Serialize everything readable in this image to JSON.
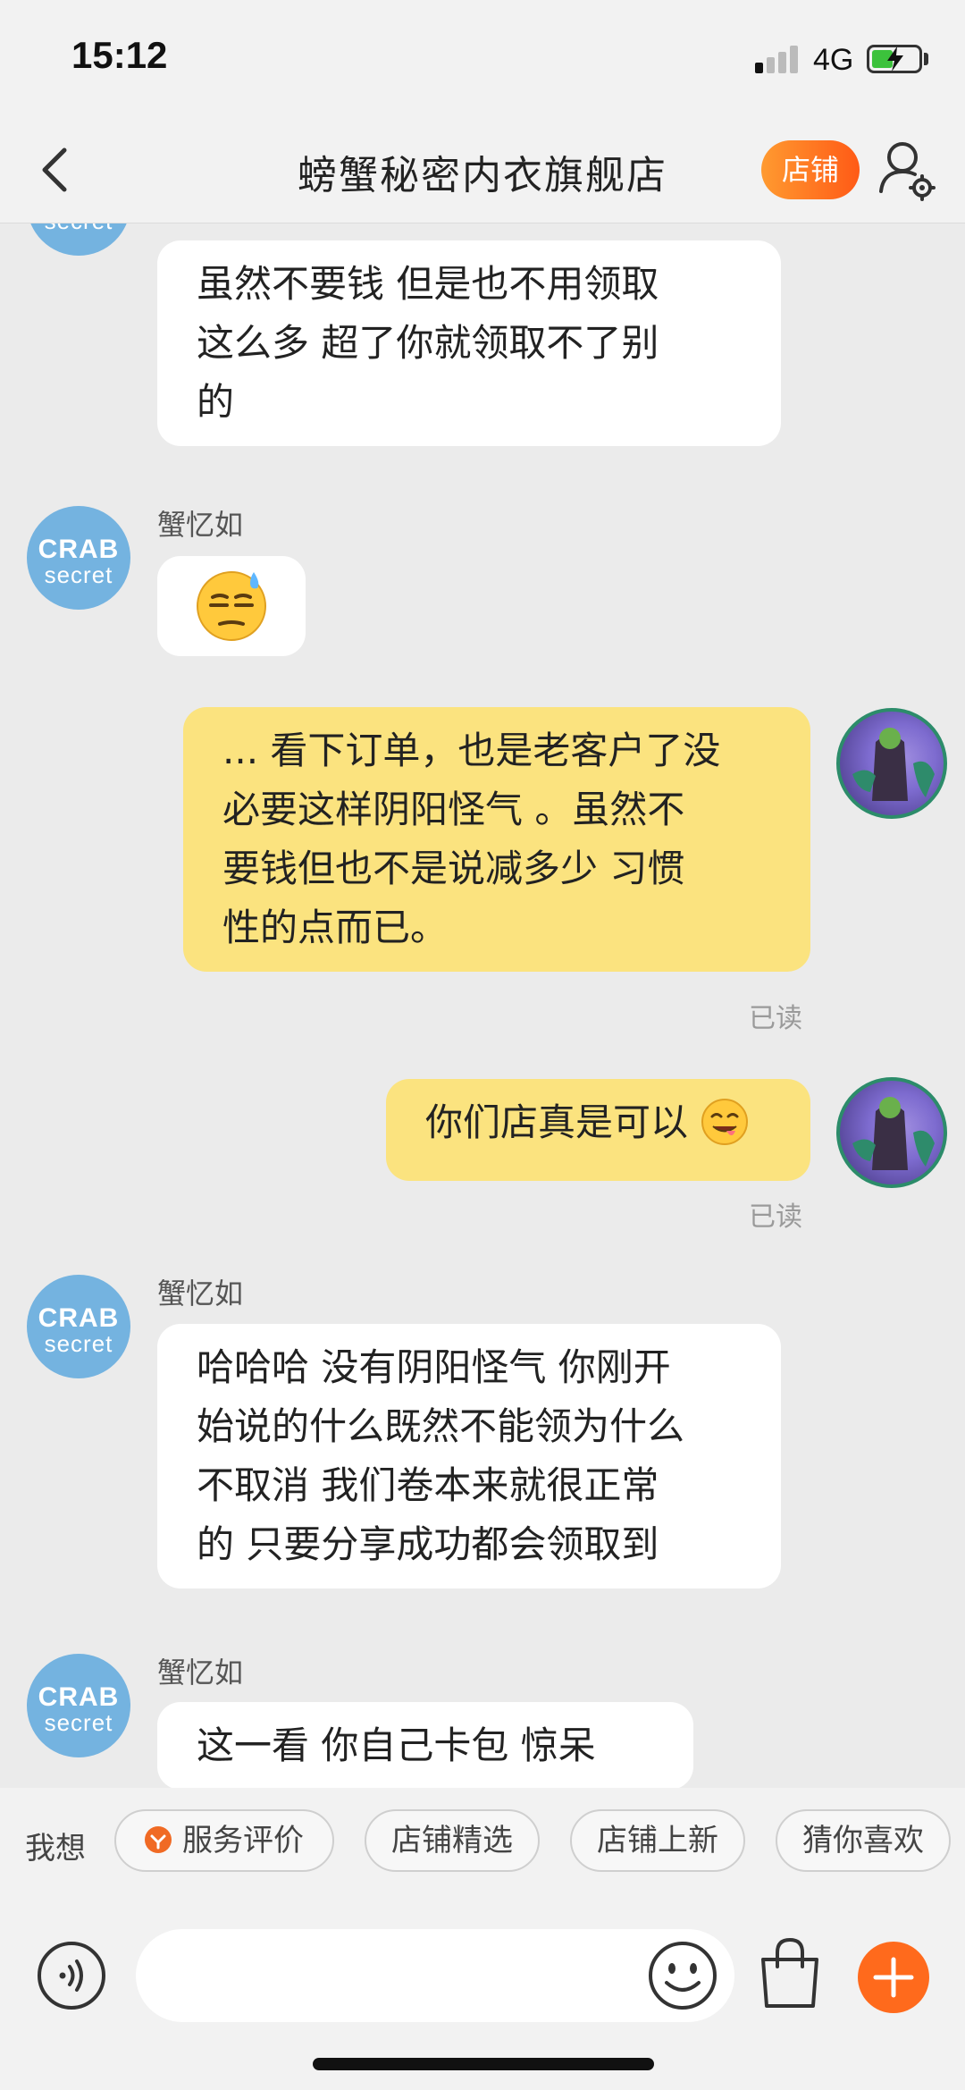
{
  "status_bar": {
    "time": "15:12",
    "network": "4G",
    "signal_bars_active": 1,
    "battery_level": 0.45,
    "battery_charging": true
  },
  "nav": {
    "back_icon": "chevron-left-icon",
    "title": "螃蟹秘密内衣旗舰店",
    "shop_button_label": "店铺",
    "user_settings_icon": "user-settings-icon"
  },
  "colors": {
    "accent_orange": "#ff6a1c",
    "my_bubble": "#fbe37f",
    "their_bubble": "#ffffff",
    "crab_avatar": "#74b3e0",
    "background": "#ebebeb"
  },
  "shop_avatar": {
    "line1": "CRAB",
    "line2": "secret"
  },
  "messages": [
    {
      "side": "left",
      "sender": "",
      "lines": [
        "虽然不要钱  但是也不用领取",
        "这么多    超了你就领取不了别",
        "的"
      ]
    },
    {
      "side": "left",
      "sender": "蟹忆如",
      "emoji": "😓"
    },
    {
      "side": "right",
      "lines": [
        "... 看下订单，也是老客户了没",
        "必要这样阴阳怪气  。虽然不",
        "要钱但也不是说减多少 习惯",
        "性的点而已。"
      ],
      "status": "已读"
    },
    {
      "side": "right",
      "text": "你们店真是可以",
      "emoji": "😋",
      "status": "已读"
    },
    {
      "side": "left",
      "sender": "蟹忆如",
      "lines": [
        "哈哈哈  没有阴阳怪气  你刚开",
        "始说的什么既然不能领为什么",
        "不取消  我们卷本来就很正常",
        "的  只要分享成功都会领取到"
      ]
    },
    {
      "side": "left",
      "sender": "蟹忆如",
      "lines": [
        "这一看  你自己卡包  惊呆"
      ]
    }
  ],
  "quick_replies": {
    "prefix": "我想",
    "chips": [
      "服务评价",
      "店铺精选",
      "店铺上新",
      "猜你喜欢"
    ]
  },
  "input_bar": {
    "voice_icon": "voice-icon",
    "placeholder": "",
    "emoji_icon": "emoji-icon",
    "cart_icon": "shopping-bag-icon",
    "plus_icon": "plus-icon"
  }
}
